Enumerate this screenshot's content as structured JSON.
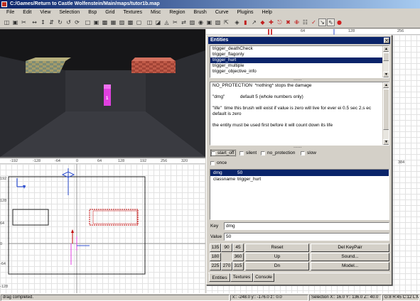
{
  "window": {
    "title": "C:/Games/Return to Castle Wolfenstein/Main/maps/tutor1b.map"
  },
  "menu": [
    "File",
    "Edit",
    "View",
    "Selection",
    "Bsp",
    "Grid",
    "Textures",
    "Misc",
    "Region",
    "Brush",
    "Curve",
    "Plugins",
    "Help"
  ],
  "toolbar": {
    "icons": [
      "open-icon",
      "save-icon",
      "cut-icon",
      "flip-x-icon",
      "flip-y-icon",
      "flip-z-icon",
      "rotate-x-icon",
      "rotate-y-icon",
      "rotate-z-icon",
      "select-complete-icon",
      "select-touching-icon",
      "select-partial-icon",
      "select-inside-icon",
      "csg-subtract-icon",
      "csg-merge-icon",
      "hollow-icon",
      "view-xy-icon",
      "view-xz-icon",
      "view-yz-icon",
      "clipper-icon",
      "change-view-icon",
      "texture-lock-icon",
      "camera-icon",
      "cubic-clip-icon",
      "patch-icon",
      "scale-icon",
      "show-entities-icon",
      "brush-icon",
      "drag-edges-icon",
      "drag-vertices-icon",
      "bend-icon",
      "cap-icon",
      "weld-icon",
      "thicken-icon",
      "inspector-icon",
      "wireframe-icon",
      "select-icon",
      "point-icon",
      "record-icon"
    ]
  },
  "camera": {
    "entity_label": "1"
  },
  "xy_view": {
    "top_ruler": [
      "-192",
      "-128",
      "-64",
      "0",
      "64",
      "128",
      "192",
      "256",
      "320"
    ],
    "left_ruler": [
      "192",
      "128",
      "64",
      "0",
      "-64",
      "-128"
    ]
  },
  "xy_view_right": {
    "top_ruler": [
      "64",
      "128",
      "256"
    ],
    "top_ruler_right": [
      "384"
    ]
  },
  "entities_window": {
    "title": "Entities",
    "classnames": [
      "trigger_deathCheck",
      "trigger_flagonly",
      "trigger_hurt",
      "trigger_multiple",
      "trigger_objective_info"
    ],
    "selected_class_index": 2,
    "description": "NO_PROTECTION  *nothing* stops the damage\n\n\"dmg\"            default 5 (whole numbers only)\n\n\"life\"  time this brush will exist if value is zero will live for ever ei 0.5 sec 2.s ec\ndefault is zero\n\nthe entity must be used first before it will count down its life",
    "spawnflags": [
      "start_off",
      "silent",
      "no_protection",
      "slow",
      "once"
    ],
    "properties": [
      {
        "key": "dmg",
        "value": "50"
      },
      {
        "key": "classname",
        "value": "trigger_hurt"
      }
    ],
    "key_label": "Key",
    "key_value": "dmg",
    "value_label": "Value",
    "value_value": "50",
    "angles": [
      [
        "135",
        "90",
        "45"
      ],
      [
        "180",
        "",
        "360"
      ],
      [
        "225",
        "270",
        "315"
      ]
    ],
    "buttons": {
      "reset": "Reset",
      "up": "Up",
      "dn": "Dn",
      "del_keypair": "Del KeyPair",
      "sound": "Sound...",
      "model": "Model..."
    },
    "tabs": [
      "Entities",
      "Textures",
      "Console"
    ]
  },
  "status": {
    "message": "drag completed.",
    "coords": "x:: -248.0  y:: -176.0  z:: 0.0",
    "selection": "Selection X:: 16.0  Y:: 136.0  Z:: 40.0",
    "grid": "G:8 R:45 C:12 L:MR"
  }
}
